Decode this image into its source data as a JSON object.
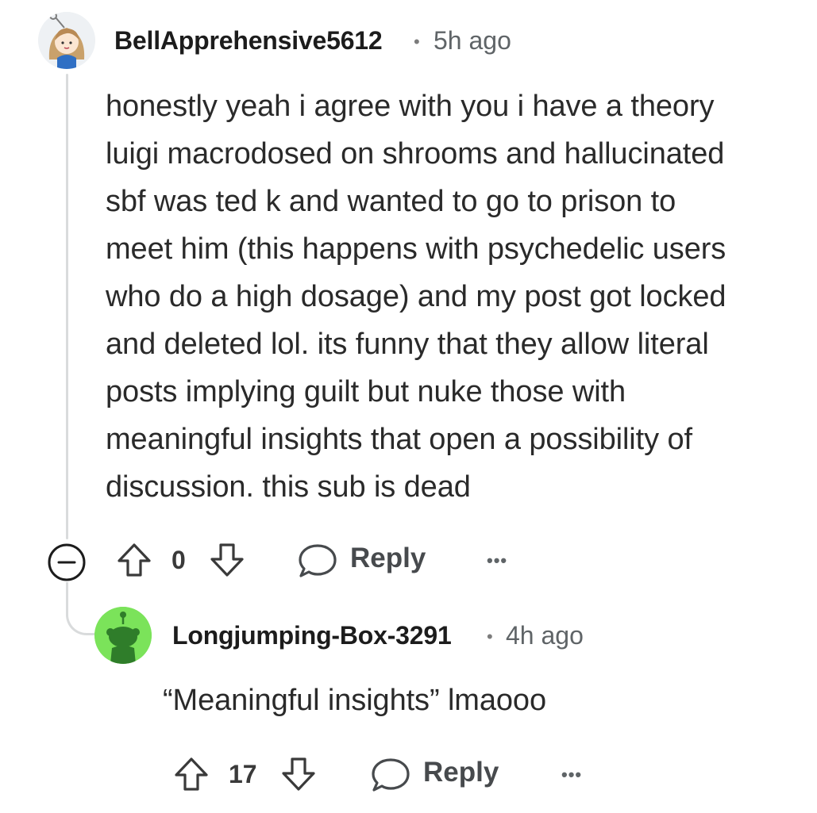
{
  "comment1": {
    "username": "BellApprehensive5612",
    "time": "5h ago",
    "body_lines": [
      "honestly yeah i agree with you i have a theory",
      "luigi macrodosed on shrooms and hallucinated",
      "sbf was ted k and wanted to go to prison to",
      "meet him (this happens with psychedelic users",
      "who do a high dosage) and my post got locked",
      "and deleted lol. its funny that they allow literal",
      "posts implying guilt but nuke those with",
      "meaningful insights that open a possibility of",
      "discussion. this sub is dead"
    ],
    "vote_count": "0",
    "reply_label": "Reply",
    "more_label": "•••",
    "collapse_icon": "minus-circle-icon"
  },
  "comment2": {
    "username": "Longjumping-Box-3291",
    "time": "4h ago",
    "body": "“Meaningful insights” lmaooo",
    "vote_count": "17",
    "reply_label": "Reply",
    "more_label": "•••"
  },
  "separator": "•",
  "colors": {
    "text": "#1c1c1c",
    "meta": "#5f6467",
    "thread": "#d9dbdc",
    "avatar2_bg": "#7be35a",
    "snoo": "#2f7d2a"
  }
}
